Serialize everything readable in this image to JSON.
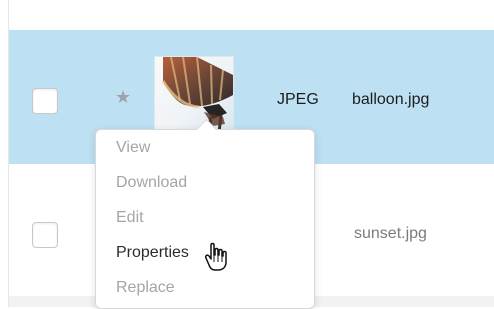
{
  "files": [
    {
      "type": "JPEG",
      "name": "balloon.jpg",
      "selected": true,
      "thumbnail_icon": "hot-air-balloon-thumbnail"
    },
    {
      "type": "G",
      "name": "sunset.jpg",
      "selected": false
    }
  ],
  "context_menu": {
    "items": [
      {
        "label": "View",
        "enabled": false
      },
      {
        "label": "Download",
        "enabled": false
      },
      {
        "label": "Edit",
        "enabled": false
      },
      {
        "label": "Properties",
        "enabled": true
      },
      {
        "label": "Replace",
        "enabled": false
      }
    ]
  },
  "icons": {
    "star": "star-icon",
    "cursor": "pointing-hand-cursor"
  },
  "colors": {
    "selected_row": "#bde0f3",
    "disabled_text": "#a5a5a5",
    "enabled_text": "#2b2b2b",
    "star": "#9da4aa"
  }
}
